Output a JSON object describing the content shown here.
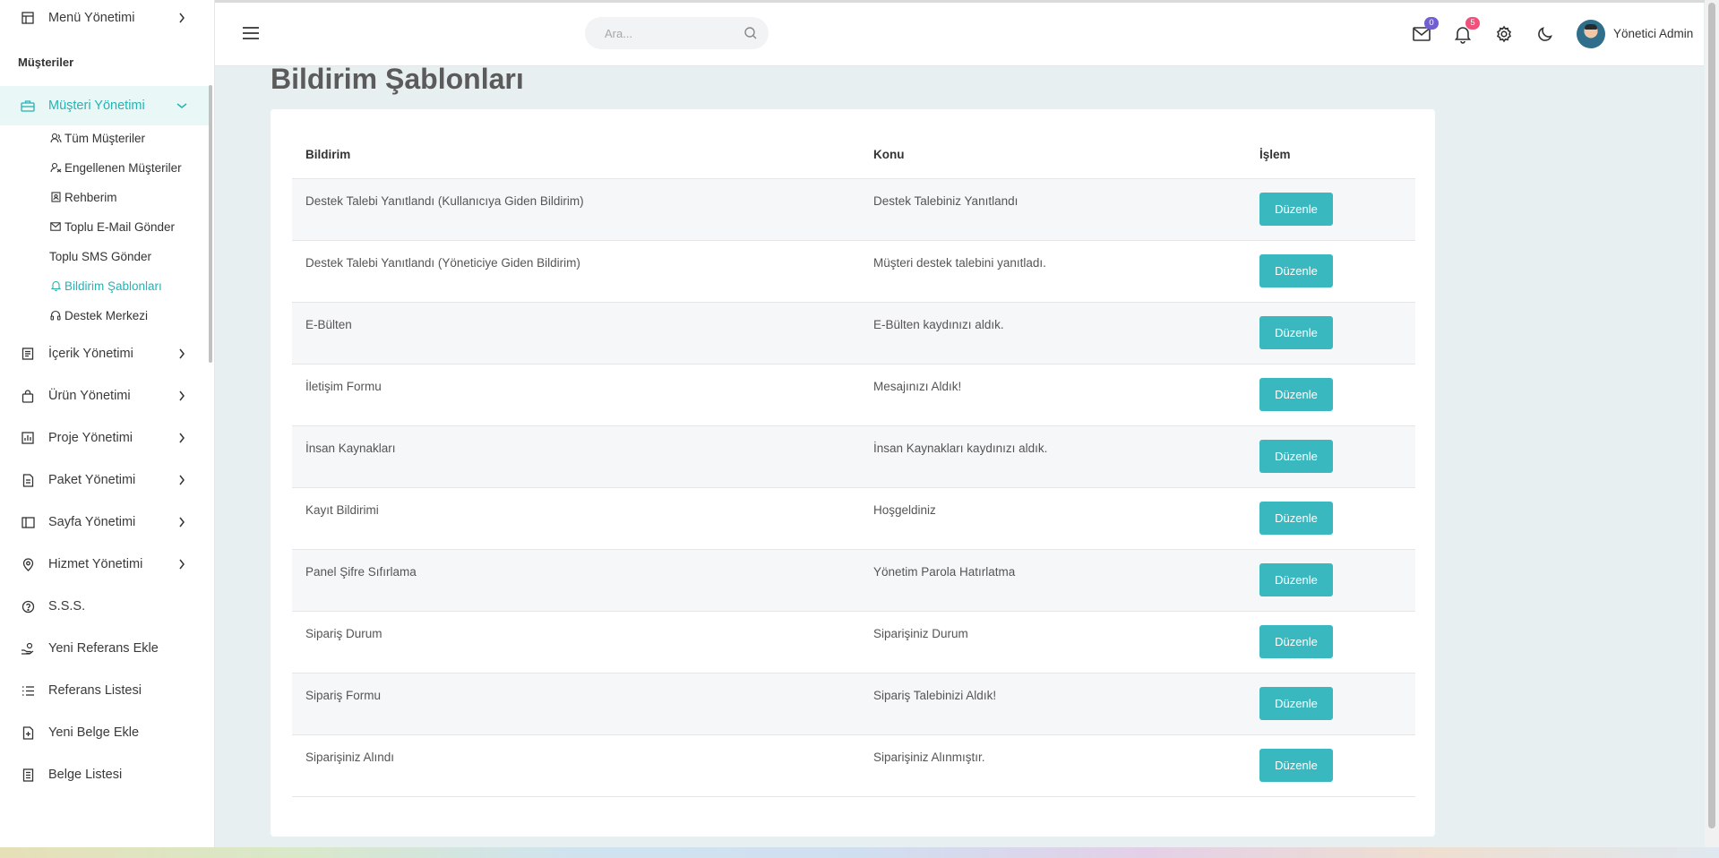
{
  "sidebar": {
    "top_item": {
      "label": "Menü Yönetimi"
    },
    "section_title": "Müşteriler",
    "active_group": {
      "label": "Müşteri Yönetimi"
    },
    "sub_items": [
      {
        "label": "Tüm Müşteriler",
        "icon": "users-icon"
      },
      {
        "label": "Engellenen Müşteriler",
        "icon": "user-block-icon"
      },
      {
        "label": "Rehberim",
        "icon": "contacts-icon"
      },
      {
        "label": "Toplu E-Mail Gönder",
        "icon": "mail-icon"
      },
      {
        "label": "Toplu SMS Gönder",
        "icon": ""
      },
      {
        "label": "Bildirim Şablonları",
        "icon": "bell-icon",
        "active": true
      },
      {
        "label": "Destek Merkezi",
        "icon": "headset-icon"
      }
    ],
    "groups": [
      {
        "label": "İçerik Yönetimi"
      },
      {
        "label": "Ürün Yönetimi"
      },
      {
        "label": "Proje Yönetimi"
      },
      {
        "label": "Paket Yönetimi"
      },
      {
        "label": "Sayfa Yönetimi"
      },
      {
        "label": "Hizmet Yönetimi"
      }
    ],
    "items": [
      {
        "label": "S.S.S."
      },
      {
        "label": "Yeni Referans Ekle"
      },
      {
        "label": "Referans Listesi"
      },
      {
        "label": "Yeni Belge Ekle"
      },
      {
        "label": "Belge Listesi"
      }
    ]
  },
  "header": {
    "search_placeholder": "Ara...",
    "mail_badge": "0",
    "notification_badge": "5",
    "user_name": "Yönetici Admin",
    "colors": {
      "mail_badge": "#6f5fd1",
      "notification_badge": "#f0507a"
    }
  },
  "main": {
    "page_title": "Bildirim Şablonları",
    "table": {
      "headers": [
        "Bildirim",
        "Konu",
        "İşlem"
      ],
      "rows": [
        {
          "bildirim": "Destek Talebi Yanıtlandı (Kullanıcıya Giden Bildirim)",
          "konu": "Destek Talebiniz Yanıtlandı",
          "action": "Düzenle"
        },
        {
          "bildirim": "Destek Talebi Yanıtlandı (Yöneticiye Giden Bildirim)",
          "konu": "Müşteri destek talebini yanıtladı.",
          "action": "Düzenle"
        },
        {
          "bildirim": "E-Bülten",
          "konu": "E-Bülten kaydınızı aldık.",
          "action": "Düzenle"
        },
        {
          "bildirim": "İletişim Formu",
          "konu": "Mesajınızı Aldık!",
          "action": "Düzenle"
        },
        {
          "bildirim": "İnsan Kaynakları",
          "konu": "İnsan Kaynakları kaydınızı aldık.",
          "action": "Düzenle"
        },
        {
          "bildirim": "Kayıt Bildirimi",
          "konu": "Hoşgeldiniz",
          "action": "Düzenle"
        },
        {
          "bildirim": "Panel Şifre Sıfırlama",
          "konu": "Yönetim Parola Hatırlatma",
          "action": "Düzenle"
        },
        {
          "bildirim": "Sipariş Durum",
          "konu": "Siparişiniz Durum",
          "action": "Düzenle"
        },
        {
          "bildirim": "Sipariş Formu",
          "konu": "Sipariş Talebinizi Aldık!",
          "action": "Düzenle"
        },
        {
          "bildirim": "Siparişiniz Alındı",
          "konu": "Siparişiniz Alınmıştır.",
          "action": "Düzenle"
        }
      ]
    },
    "accent_color": "#3ab8c0"
  }
}
